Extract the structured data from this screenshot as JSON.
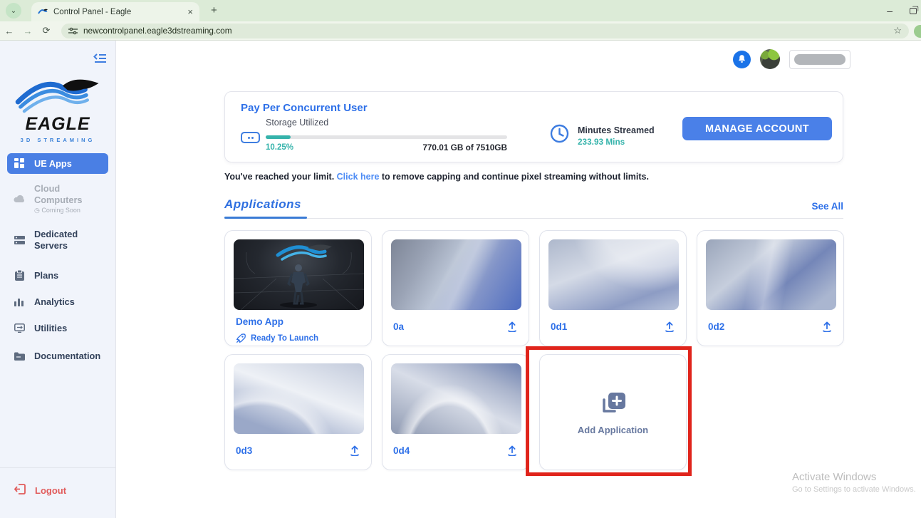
{
  "browser": {
    "tab_title": "Control Panel - Eagle",
    "url": "newcontrolpanel.eagle3dstreaming.com",
    "new_tab_label": "+",
    "close_tab_label": "×"
  },
  "sidebar": {
    "logo_title": "EAGLE",
    "logo_subtitle": "3D STREAMING",
    "items": [
      {
        "label": "UE Apps",
        "state": "active"
      },
      {
        "label": "Cloud Computers",
        "sublabel": "Coming Soon",
        "state": "disabled"
      },
      {
        "label": "Dedicated Servers",
        "state": "normal"
      },
      {
        "label": "Plans",
        "state": "normal"
      },
      {
        "label": "Analytics",
        "state": "normal"
      },
      {
        "label": "Utilities",
        "state": "normal"
      },
      {
        "label": "Documentation",
        "state": "normal"
      }
    ],
    "logout_label": "Logout"
  },
  "billing": {
    "plan_title": "Pay Per Concurrent User",
    "storage_label": "Storage Utilized",
    "storage_percent": "10.25%",
    "storage_percent_value": 10.25,
    "storage_detail": "770.01 GB of 7510GB",
    "minutes_label": "Minutes Streamed",
    "minutes_value": "233.93 Mins",
    "manage_button": "MANAGE ACCOUNT"
  },
  "limit_notice": {
    "prefix": "You've reached your limit. ",
    "link": "Click here",
    "suffix": " to remove capping and continue pixel streaming without limits."
  },
  "applications": {
    "title": "Applications",
    "see_all": "See All",
    "cards": [
      {
        "name": "Demo App",
        "status": "Ready To Launch"
      },
      {
        "name": "0a"
      },
      {
        "name": "0d1"
      },
      {
        "name": "0d2"
      },
      {
        "name": "0d3"
      },
      {
        "name": "0d4"
      }
    ],
    "add_card_label": "Add Application"
  },
  "watermark": {
    "line1": "Activate Windows",
    "line2": "Go to Settings to activate Windows."
  },
  "colors": {
    "accent_blue": "#2e70e8",
    "button_blue": "#4a80e8",
    "teal": "#35b3ab",
    "annotation_red": "#e0241b",
    "logout_red": "#e15b5b",
    "sidebar_bg": "#f1f4fb",
    "chrome_green": "#dcebd7"
  }
}
